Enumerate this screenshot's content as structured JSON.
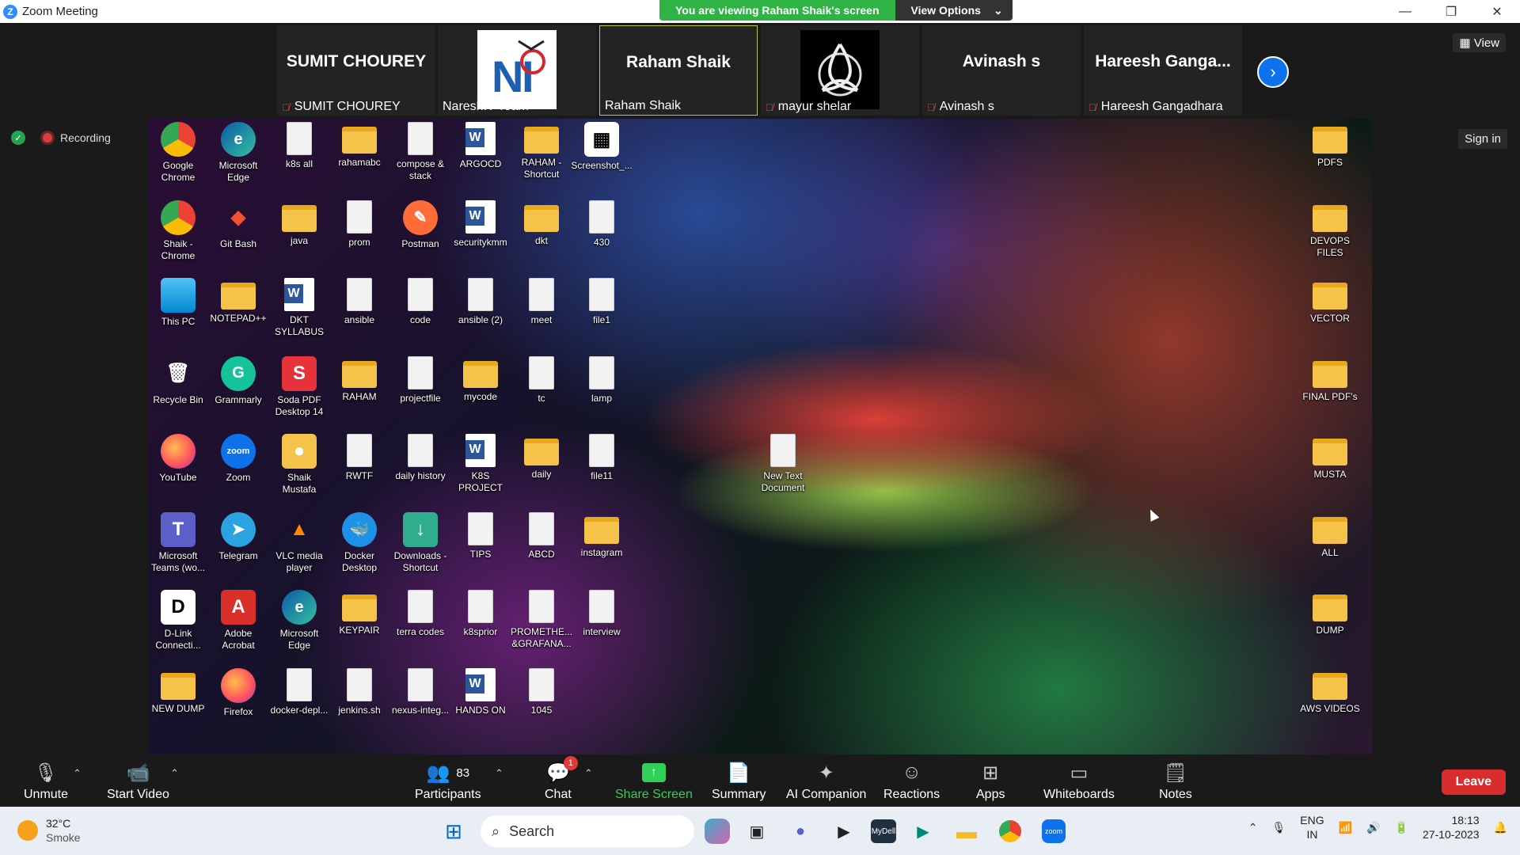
{
  "window": {
    "title": "Zoom Meeting"
  },
  "share_banner": {
    "message": "You are viewing Raham Shaik's screen",
    "options_label": "View Options"
  },
  "participants_strip": [
    {
      "display": "SUMIT CHOUREY",
      "name": "SUMIT CHOUREY",
      "muted": true,
      "video": false
    },
    {
      "display": "",
      "name": "NareshIT Team",
      "muted": false,
      "video": true
    },
    {
      "display": "Raham Shaik",
      "name": "Raham Shaik",
      "muted": false,
      "video": false,
      "active": true
    },
    {
      "display": "",
      "name": "mayur shelar",
      "muted": true,
      "video": true
    },
    {
      "display": "Avinash s",
      "name": "Avinash s",
      "muted": true,
      "video": false
    },
    {
      "display": "Hareesh Ganga...",
      "name": "Hareesh Gangadhara",
      "muted": true,
      "video": false
    }
  ],
  "view_label": "View",
  "recording_label": "Recording",
  "signin_label": "Sign in",
  "desktop": {
    "columns": [
      [
        {
          "label": "Google Chrome",
          "icon": "chrome"
        },
        {
          "label": "Shaik - Chrome",
          "icon": "chrome"
        },
        {
          "label": "This PC",
          "icon": "monitor"
        },
        {
          "label": "Recycle Bin",
          "icon": "recycle"
        },
        {
          "label": "YouTube",
          "icon": "firefox"
        },
        {
          "label": "Microsoft Teams (wo...",
          "icon": "teams"
        },
        {
          "label": "D-Link Connecti...",
          "icon": "dlink"
        },
        {
          "label": "NEW DUMP",
          "icon": "folder"
        }
      ],
      [
        {
          "label": "Microsoft Edge",
          "icon": "edge"
        },
        {
          "label": "Git Bash",
          "icon": "git"
        },
        {
          "label": "NOTEPAD++",
          "icon": "folder"
        },
        {
          "label": "Grammarly",
          "icon": "grammarly"
        },
        {
          "label": "Zoom",
          "icon": "zoom"
        },
        {
          "label": "Telegram",
          "icon": "telegram"
        },
        {
          "label": "Adobe Acrobat",
          "icon": "acrobat"
        },
        {
          "label": "Firefox",
          "icon": "firefox"
        }
      ],
      [
        {
          "label": "k8s all",
          "icon": "doc"
        },
        {
          "label": "java",
          "icon": "folder"
        },
        {
          "label": "DKT SYLLABUS",
          "icon": "word"
        },
        {
          "label": "Soda PDF Desktop 14",
          "icon": "soda"
        },
        {
          "label": "Shaik Mustafa",
          "icon": "user-folder"
        },
        {
          "label": "VLC media player",
          "icon": "vlc"
        },
        {
          "label": "Microsoft Edge",
          "icon": "edge"
        },
        {
          "label": "docker-depl...",
          "icon": "doc"
        }
      ],
      [
        {
          "label": "rahamabc",
          "icon": "folder"
        },
        {
          "label": "prom",
          "icon": "doc"
        },
        {
          "label": "ansible",
          "icon": "doc"
        },
        {
          "label": "RAHAM",
          "icon": "folder"
        },
        {
          "label": "RWTF",
          "icon": "doc"
        },
        {
          "label": "Docker Desktop",
          "icon": "docker"
        },
        {
          "label": "KEYPAIR",
          "icon": "folder"
        },
        {
          "label": "jenkins.sh",
          "icon": "doc"
        }
      ],
      [
        {
          "label": "compose & stack",
          "icon": "doc"
        },
        {
          "label": "Postman",
          "icon": "postman"
        },
        {
          "label": "code",
          "icon": "doc"
        },
        {
          "label": "projectfile",
          "icon": "doc"
        },
        {
          "label": "daily history",
          "icon": "doc"
        },
        {
          "label": "Downloads - Shortcut",
          "icon": "downloads"
        },
        {
          "label": "terra codes",
          "icon": "doc"
        },
        {
          "label": "nexus-integ...",
          "icon": "doc"
        }
      ],
      [
        {
          "label": "ARGOCD",
          "icon": "word"
        },
        {
          "label": "securitykmm",
          "icon": "word"
        },
        {
          "label": "ansible (2)",
          "icon": "doc"
        },
        {
          "label": "mycode",
          "icon": "folder"
        },
        {
          "label": "K8S PROJECT",
          "icon": "word"
        },
        {
          "label": "TIPS",
          "icon": "doc"
        },
        {
          "label": "k8sprior",
          "icon": "doc"
        },
        {
          "label": "HANDS ON",
          "icon": "word"
        }
      ],
      [
        {
          "label": "RAHAM - Shortcut",
          "icon": "folder"
        },
        {
          "label": "dkt",
          "icon": "folder"
        },
        {
          "label": "meet",
          "icon": "doc"
        },
        {
          "label": "tc",
          "icon": "doc"
        },
        {
          "label": "daily",
          "icon": "folder"
        },
        {
          "label": "ABCD",
          "icon": "doc"
        },
        {
          "label": "PROMETHE... &GRAFANA...",
          "icon": "doc"
        },
        {
          "label": "1045",
          "icon": "doc"
        }
      ],
      [
        {
          "label": "Screenshot_...",
          "icon": "qr"
        },
        {
          "label": "430",
          "icon": "doc"
        },
        {
          "label": "file1",
          "icon": "doc"
        },
        {
          "label": "lamp",
          "icon": "doc"
        },
        {
          "label": "file11",
          "icon": "doc"
        },
        {
          "label": "instagram",
          "icon": "folder"
        },
        {
          "label": "interview",
          "icon": "doc"
        },
        null
      ]
    ],
    "extra_icon": {
      "label": "New Text Document",
      "icon": "doc"
    },
    "right_column": [
      {
        "label": "PDFS",
        "icon": "folder"
      },
      {
        "label": "DEVOPS FILES",
        "icon": "folder"
      },
      {
        "label": "VECTOR",
        "icon": "folder"
      },
      {
        "label": "FINAL PDF's",
        "icon": "folder"
      },
      {
        "label": "MUSTA",
        "icon": "folder"
      },
      {
        "label": "ALL",
        "icon": "folder"
      },
      {
        "label": "DUMP",
        "icon": "folder"
      },
      {
        "label": "AWS VIDEOS",
        "icon": "folder"
      }
    ]
  },
  "toolbar": {
    "unmute": "Unmute",
    "start_video": "Start Video",
    "participants": "Participants",
    "participants_count": "83",
    "chat": "Chat",
    "chat_badge": "1",
    "share_screen": "Share Screen",
    "summary": "Summary",
    "ai_companion": "AI Companion",
    "reactions": "Reactions",
    "apps": "Apps",
    "whiteboards": "Whiteboards",
    "notes": "Notes",
    "leave": "Leave"
  },
  "taskbar": {
    "temperature": "32°C",
    "weather": "Smoke",
    "search_placeholder": "Search",
    "lang_top": "ENG",
    "lang_bottom": "IN",
    "time": "18:13",
    "date": "27-10-2023"
  },
  "colors": {
    "zoom_blue": "#0e72ed",
    "share_green": "#2fb344",
    "leave_red": "#d92d2d",
    "folder_yellow": "#f6c34a"
  }
}
